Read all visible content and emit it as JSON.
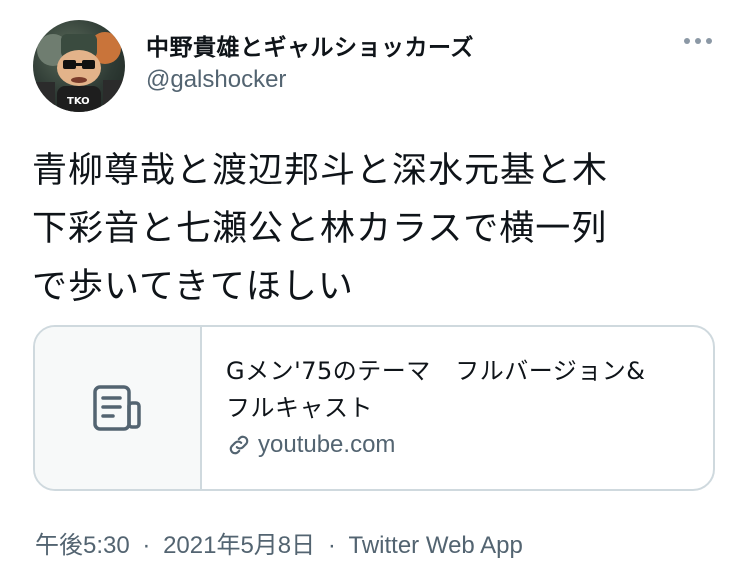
{
  "header": {
    "display_name": "中野貴雄とギャルショッカーズ",
    "handle": "@galshocker"
  },
  "tweet": {
    "text": "青柳尊哉と渡辺邦斗と深水元基と木\n下彩音と七瀬公と林カラスで横一列\nで歩いてきてほしい"
  },
  "card": {
    "title": "Gメン'75のテーマ　フルバージョン&\nフルキャスト",
    "domain": "youtube.com",
    "icon": "document-icon",
    "link_icon": "link-icon"
  },
  "footer": {
    "time": "午後5:30",
    "separator": "·",
    "date": "2021年5月8日",
    "source": "Twitter Web App"
  },
  "colors": {
    "secondary_text": "#536471",
    "border": "#cfd9de",
    "card_thumb_bg": "#f7f9f9"
  }
}
